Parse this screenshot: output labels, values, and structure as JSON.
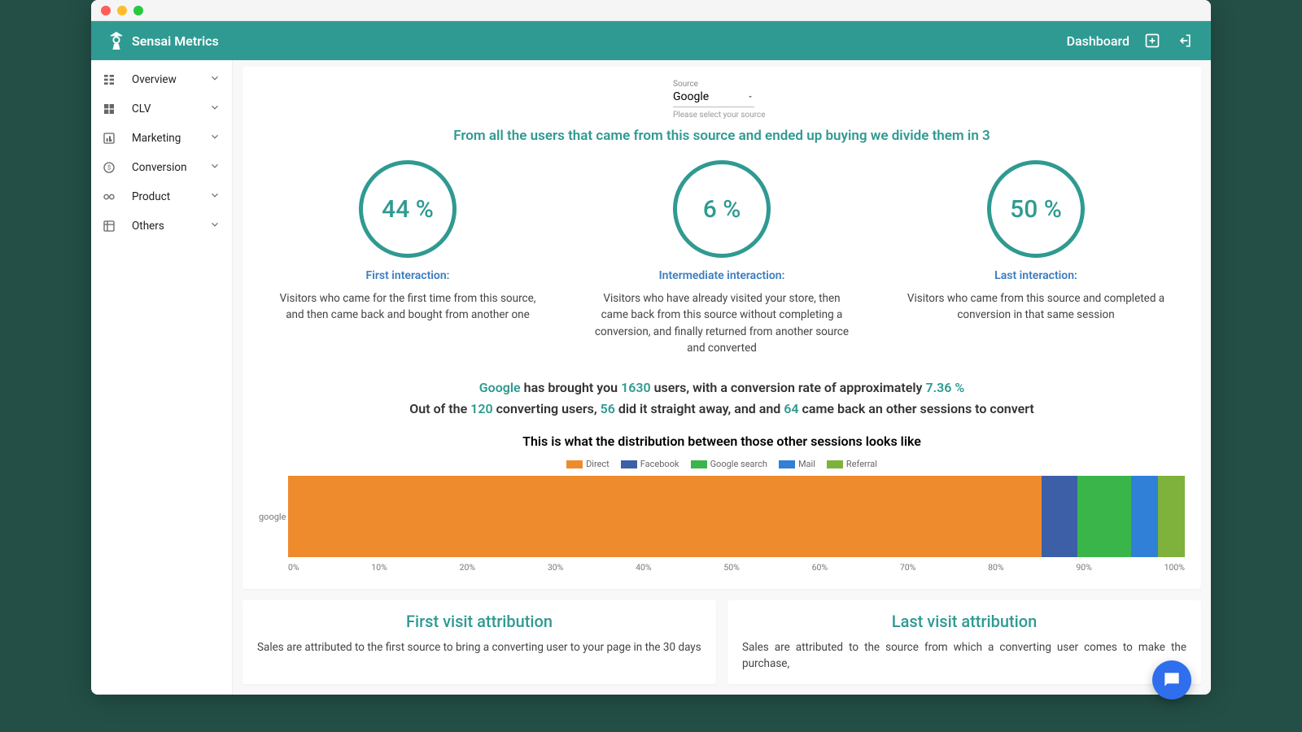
{
  "brand": {
    "name": "Sensai Metrics"
  },
  "appbar": {
    "dashboard": "Dashboard"
  },
  "sidebar": {
    "items": [
      {
        "label": "Overview"
      },
      {
        "label": "CLV"
      },
      {
        "label": "Marketing"
      },
      {
        "label": "Conversion"
      },
      {
        "label": "Product"
      },
      {
        "label": "Others"
      }
    ]
  },
  "source": {
    "label": "Source",
    "value": "Google",
    "hint": "Please select your source"
  },
  "headline": "From all the users that came from this source and ended up buying we divide them in 3",
  "interactions": [
    {
      "value": "44 %",
      "title": "First interaction:",
      "desc": "Visitors who came for the first time from this source, and then came back and bought from another one"
    },
    {
      "value": "6 %",
      "title": "Intermediate interaction:",
      "desc": "Visitors who have already visited your store, then came back from this source without completing a conversion, and finally returned from another source and converted"
    },
    {
      "value": "50 %",
      "title": "Last interaction:",
      "desc": "Visitors who came from this source and completed a conversion in that same session"
    }
  ],
  "summary": {
    "source": "Google",
    "t1": " has brought you ",
    "users": "1630",
    "t2": " users, with a conversion rate of approximately ",
    "rate": "7.36 %",
    "line2_a": "Out of the ",
    "converting": "120",
    "line2_b": " converting users, ",
    "straight": "56",
    "line2_c": " did it straight away, and and ",
    "returning": "64",
    "line2_d": " came back an other sessions to convert"
  },
  "dist_title": "This is what the distribution between those other sessions looks like",
  "legend": [
    {
      "label": "Direct",
      "color": "#ee8b2d"
    },
    {
      "label": "Facebook",
      "color": "#3c5fa8"
    },
    {
      "label": "Google search",
      "color": "#3ab54a"
    },
    {
      "label": "Mail",
      "color": "#2f80d6"
    },
    {
      "label": "Referral",
      "color": "#7fb23c"
    }
  ],
  "chart_data": {
    "type": "bar",
    "orientation": "horizontal-stacked",
    "categories": [
      "google"
    ],
    "series": [
      {
        "name": "Direct",
        "values": [
          84
        ],
        "color": "#ee8b2d"
      },
      {
        "name": "Facebook",
        "values": [
          4
        ],
        "color": "#3c5fa8"
      },
      {
        "name": "Google search",
        "values": [
          6
        ],
        "color": "#3ab54a"
      },
      {
        "name": "Mail",
        "values": [
          3
        ],
        "color": "#2f80d6"
      },
      {
        "name": "Referral",
        "values": [
          3
        ],
        "color": "#7fb23c"
      }
    ],
    "xlabel": "",
    "ylabel": "",
    "xlim": [
      0,
      100
    ],
    "x_ticks": [
      "0%",
      "10%",
      "20%",
      "30%",
      "40%",
      "50%",
      "60%",
      "70%",
      "80%",
      "90%",
      "100%"
    ]
  },
  "attribution": {
    "first": {
      "title": "First visit attribution",
      "body": "Sales are attributed to the first source to bring a converting user to your page in the 30 days"
    },
    "last": {
      "title": "Last visit attribution",
      "body": "Sales are attributed to the source from which a converting user comes to make the purchase,"
    }
  }
}
